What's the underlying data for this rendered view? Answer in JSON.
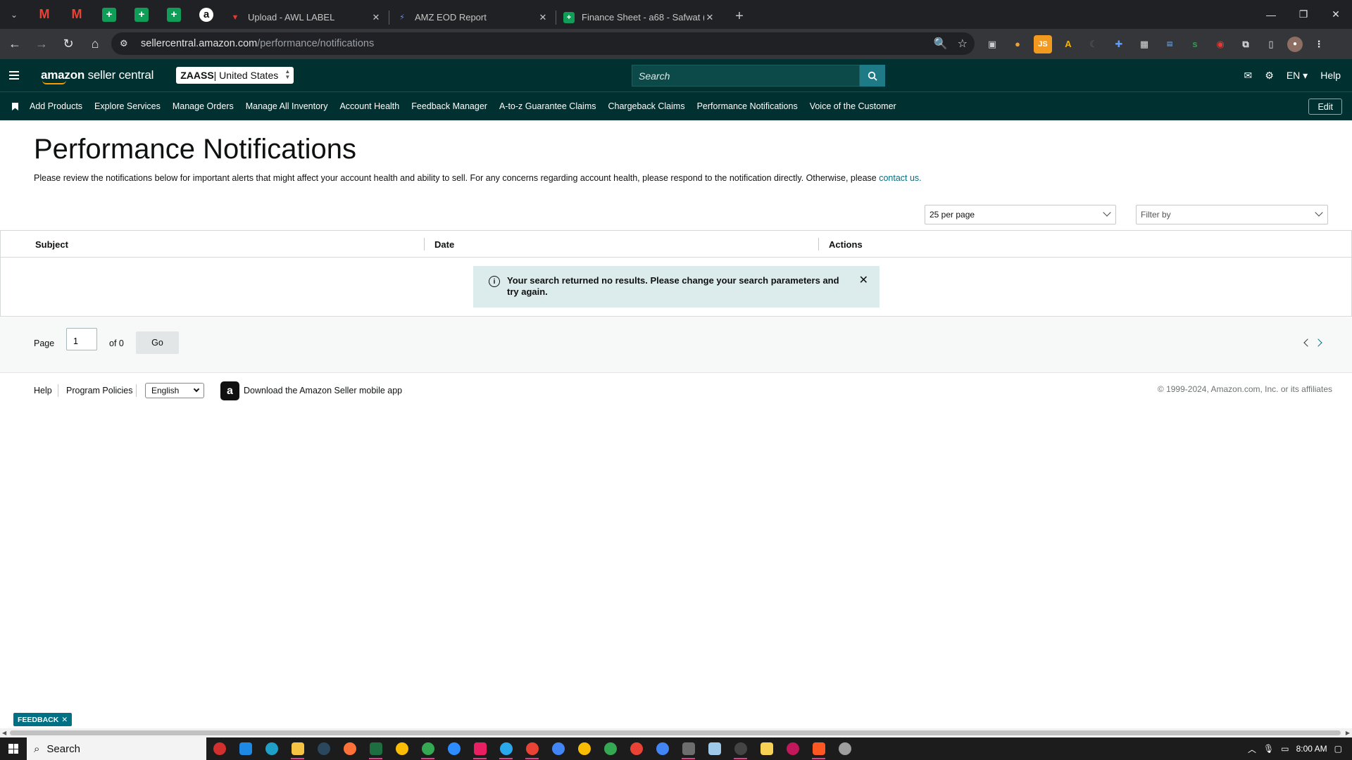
{
  "browser": {
    "tabs": [
      {
        "title": "Upload - AWL LABEL",
        "close": "✕"
      },
      {
        "title": "AMZ EOD Report",
        "close": "✕"
      },
      {
        "title": "Finance Sheet - a68 - Safwat (S...",
        "close": "✕"
      }
    ],
    "new_tab": "+",
    "url_host": "sellercentral.amazon.com",
    "url_path": "/performance/notifications",
    "window_controls": {
      "minimize": "—",
      "maximize": "❐",
      "close": "✕"
    }
  },
  "header": {
    "logo_bold": "amazon",
    "logo_rest": " seller central",
    "store_name": "ZAASS",
    "store_region": " | United States",
    "search_placeholder": "Search",
    "language": "EN ▾",
    "help": "Help"
  },
  "nav": {
    "items": [
      "Add Products",
      "Explore Services",
      "Manage Orders",
      "Manage All Inventory",
      "Account Health",
      "Feedback Manager",
      "A-to-z Guarantee Claims",
      "Chargeback Claims",
      "Performance Notifications",
      "Voice of the Customer"
    ],
    "edit": "Edit"
  },
  "page": {
    "title": "Performance Notifications",
    "description": "Please review the notifications below for important alerts that might affect your account health and ability to sell. For any concerns regarding account health, please respond to the notification directly. Otherwise, please ",
    "contact_link": "contact us.",
    "per_page": "25 per page",
    "filter_placeholder": "Filter by"
  },
  "table": {
    "columns": [
      "Subject",
      "Date",
      "Actions"
    ],
    "alert_icon": "i",
    "alert_message": "Your search returned no results. Please change your search parameters and try again.",
    "alert_close": "✕"
  },
  "pager": {
    "page_label": "Page",
    "page_value": "1",
    "of_label": "of 0",
    "go": "Go"
  },
  "footer": {
    "help": "Help",
    "program_policies": "Program Policies",
    "language": "English",
    "app_logo_letter": "a",
    "download_app": "Download the Amazon Seller mobile app",
    "copyright": "© 1999-2024, Amazon.com, Inc. or its affiliates"
  },
  "feedback": {
    "label": "FEEDBACK",
    "close": "✕"
  },
  "taskbar": {
    "search_label": "Search",
    "time": "8:00 AM"
  },
  "colors": {
    "header_bg": "#00302f",
    "search_button": "#1e7a86",
    "link": "#007185",
    "alert_bg": "#dcebeb",
    "tab_bar": "#202124"
  }
}
